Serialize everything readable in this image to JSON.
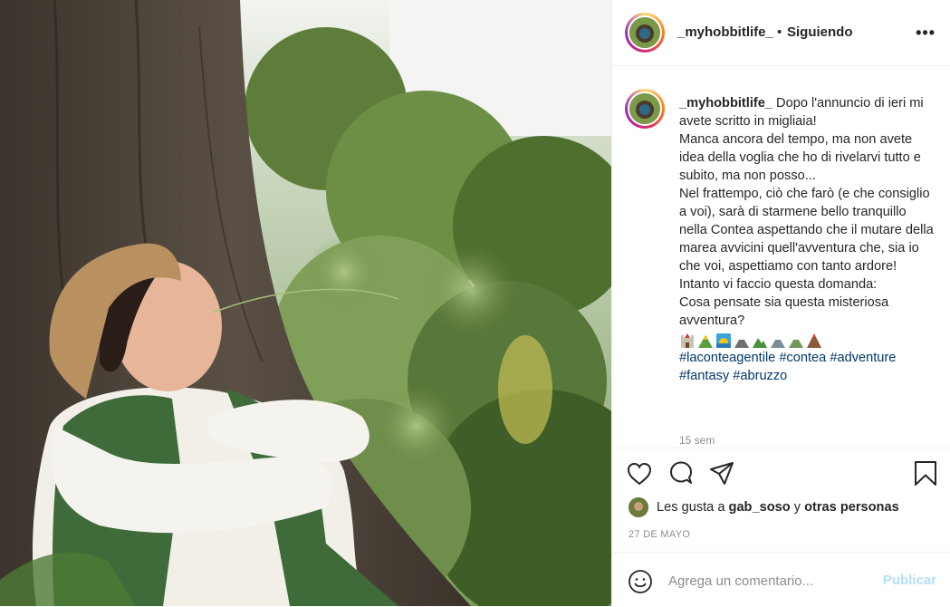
{
  "header": {
    "username": "_myhobbitlife_",
    "separator": "•",
    "follow_status": "Siguiendo",
    "more_label": "•••"
  },
  "caption": {
    "username": "_myhobbitlife_",
    "text": "Dopo l'annuncio di ieri mi avete scritto in migliaia!\nManca ancora del tempo, ma non avete idea della voglia che ho di rivelarvi tutto e subito, ma non posso...\nNel frattempo, ciò che farò (e che consiglio a voi), sarà di starmene bello tranquillo nella Contea aspettando che il mutare della marea avvicini quell'avventura che, sia io che voi, aspettiamo con tanto ardore!\nIntanto vi faccio questa domanda:\nCosa pensate sia questa misteriosa avventura?",
    "emojis": [
      "castle-emoji",
      "mountain-emoji",
      "sunrise-emoji",
      "mountain-emoji",
      "mountain-emoji",
      "snow-mountain-emoji",
      "snow-mountain-emoji",
      "volcano-emoji"
    ],
    "hashtags": [
      "#laconteagentile",
      "#contea",
      "#adventure",
      "#fantasy",
      "#abruzzo"
    ],
    "time_ago": "15 sem"
  },
  "likes": {
    "prefix": "Les gusta a",
    "user": "gab_soso",
    "conj": "y",
    "others": "otras personas"
  },
  "date": "27 DE MAYO",
  "comment": {
    "placeholder": "Agrega un comentario...",
    "post_label": "Publicar"
  },
  "colors": {
    "link": "#00376b",
    "muted": "#8e8e8e",
    "post_disabled": "#b2dffc"
  }
}
